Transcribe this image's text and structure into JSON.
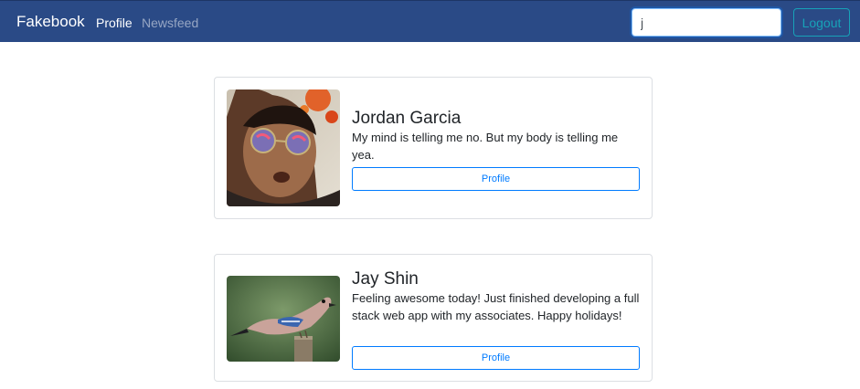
{
  "navbar": {
    "brand": "Fakebook",
    "links": [
      "Profile",
      "Newsfeed"
    ],
    "search_value": "j",
    "logout_label": "Logout"
  },
  "colors": {
    "navbar": "#2a4a86",
    "primary": "#007bff",
    "info": "#17a2b8"
  },
  "cards": [
    {
      "name": "Jordan Garcia",
      "status": "My mind is telling me no. But my body is telling me yea.",
      "button_label": "Profile",
      "avatar_icon": "person-selfie-photo"
    },
    {
      "name": "Jay Shin",
      "status": "Feeling awesome today! Just finished developing a full stack web app with my associates. Happy holidays!",
      "button_label": "Profile",
      "avatar_icon": "bird-photo"
    }
  ]
}
